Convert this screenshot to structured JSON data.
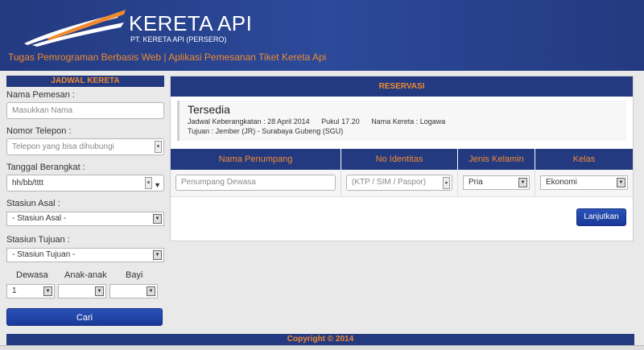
{
  "header": {
    "brand_title": "KERETA API",
    "brand_subtitle": "PT. KERETA API (PERSERO)",
    "tagline": "Tugas Pemrograman Berbasis Web | Aplikasi Pemesanan Tiket Kereta Api"
  },
  "sidebar": {
    "title": "JADWAL KERETA",
    "nama_label": "Nama Pemesan :",
    "nama_placeholder": "Masukkan Nama",
    "telepon_label": "Nomor Telepon :",
    "telepon_placeholder": "Telepon yang bisa dihubungi",
    "tanggal_label": "Tanggal Berangkat :",
    "tanggal_value": "hh/bb/tttt",
    "asal_label": "Stasiun Asal :",
    "asal_value": "- Stasiun Asal -",
    "tujuan_label": "Stasiun Tujuan :",
    "tujuan_value": "- Stasiun Tujuan -",
    "dewasa_label": "Dewasa",
    "anak_label": "Anak-anak",
    "bayi_label": "Bayi",
    "dewasa_value": "1",
    "anak_value": "",
    "bayi_value": "",
    "cari_label": "Cari"
  },
  "main": {
    "title": "RESERVASI",
    "status": "Tersedia",
    "jadwal": "Jadwal Keberangkatan : 28 April 2014",
    "pukul": "Pukul 17.20",
    "nama_kereta": "Nama Kereta : Logawa",
    "tujuan": "Tujuan : Jember (JR) - Surabaya Gubeng (SGU)",
    "columns": [
      "Nama Penumpang",
      "No Identitas",
      "Jenis Kelamin",
      "Kelas"
    ],
    "row": {
      "nama_placeholder": "Penumpang Dewasa",
      "identitas_placeholder": "(KTP / SIM / Paspor)",
      "jenis_kelamin": "Pria",
      "kelas": "Ekonomi"
    },
    "lanjutkan_label": "Lanjutkan"
  },
  "footer": {
    "copyright": "Copyright © 2014"
  }
}
